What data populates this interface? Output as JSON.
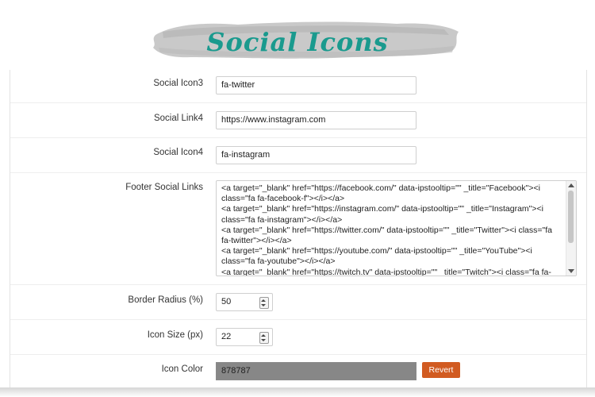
{
  "header": {
    "title": "Social Icons"
  },
  "form": {
    "social_icon3": {
      "label": "Social Icon3",
      "value": "fa-twitter"
    },
    "social_link4": {
      "label": "Social Link4",
      "value": "https://www.instagram.com"
    },
    "social_icon4": {
      "label": "Social Icon4",
      "value": "fa-instagram"
    },
    "footer_social_links": {
      "label": "Footer Social Links",
      "value": "<a target=\"_blank\" href=\"https://facebook.com/\" data-ipstooltip=\"\" _title=\"Facebook\"><i class=\"fa fa-facebook-f\"></i></a>\n<a target=\"_blank\" href=\"https://instagram.com/\" data-ipstooltip=\"\" _title=\"Instagram\"><i class=\"fa fa-instagram\"></i></a>\n<a target=\"_blank\" href=\"https://twitter.com/\" data-ipstooltip=\"\" _title=\"Twitter\"><i class=\"fa fa-twitter\"></i></a>\n<a target=\"_blank\" href=\"https://youtube.com/\" data-ipstooltip=\"\" _title=\"YouTube\"><i class=\"fa fa-youtube\"></i></a>\n<a target=\"_blank\" href=\"https://twitch.tv\" data-ipstooltip=\"\" _title=\"Twitch\"><i class=\"fa fa-"
    },
    "border_radius": {
      "label": "Border Radius (%)",
      "value": "50"
    },
    "icon_size": {
      "label": "Icon Size (px)",
      "value": "22"
    },
    "icon_color": {
      "label": "Icon Color",
      "value": "878787",
      "swatch": "#878787",
      "revert_label": "Revert"
    }
  },
  "colors": {
    "accent_title": "#1a9a8e",
    "revert_button": "#d15b21"
  }
}
